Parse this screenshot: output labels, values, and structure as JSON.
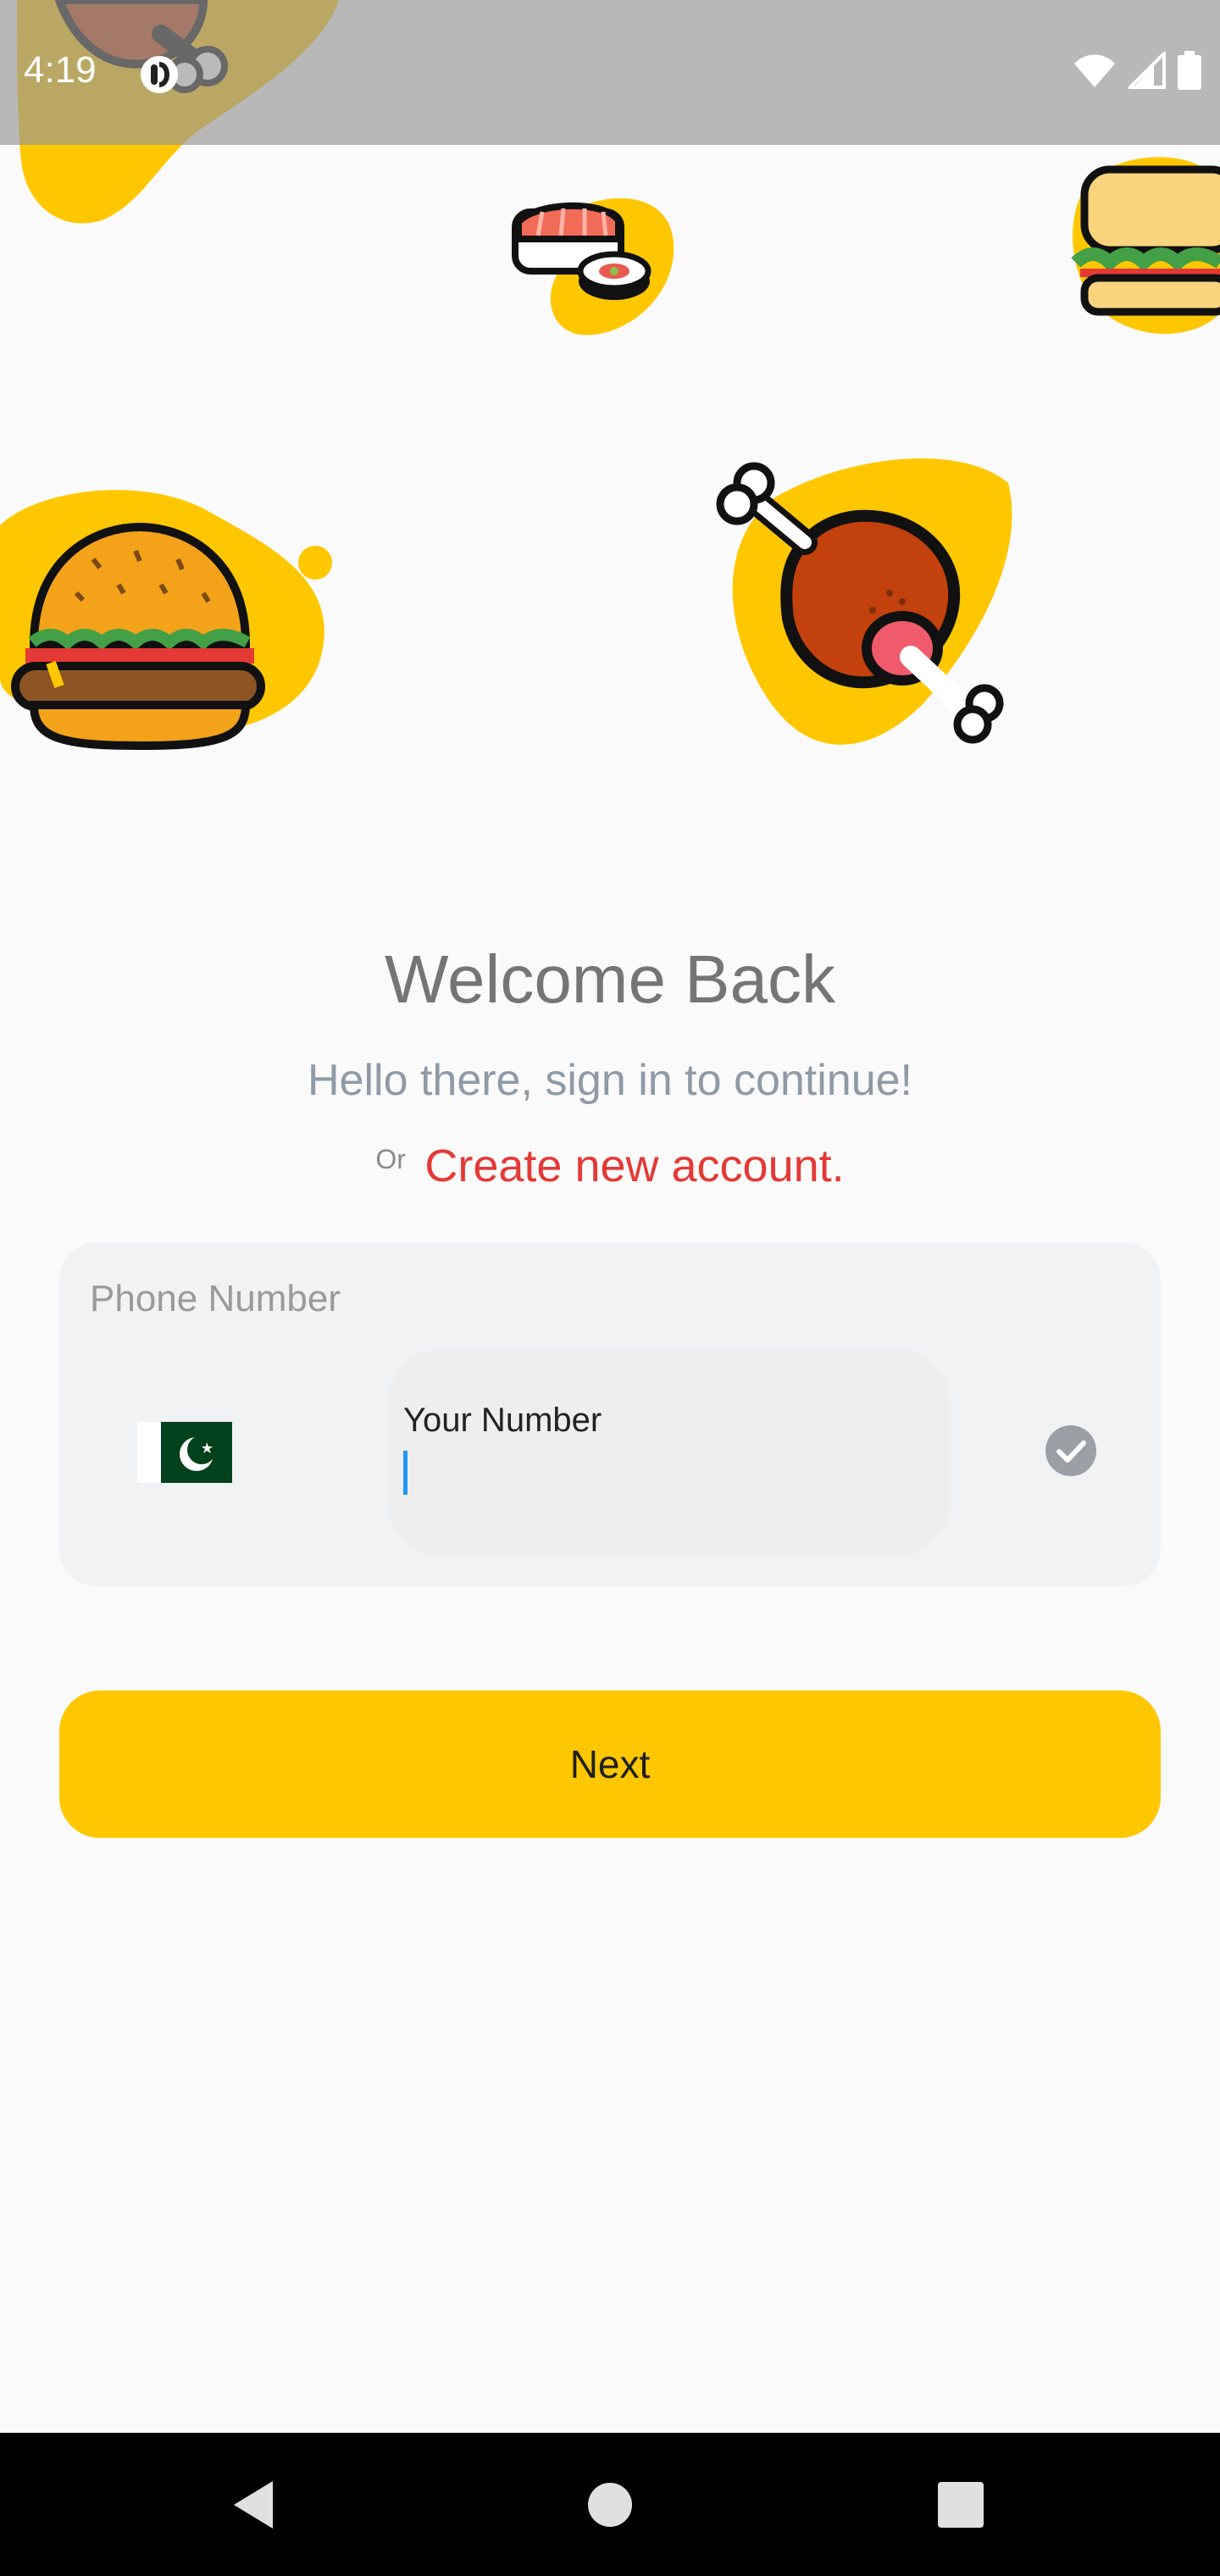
{
  "status_bar": {
    "time": "4:19",
    "icons": [
      "app-notification-icon",
      "wifi-icon",
      "signal-icon",
      "battery-icon"
    ]
  },
  "illustrations": [
    "drumstick-icon",
    "sushi-icon",
    "sandwich-icon",
    "burger-icon",
    "drumstick-icon"
  ],
  "welcome": {
    "title": "Welcome Back",
    "subtitle": "Hello there, sign in to continue!",
    "or_label": "Or",
    "create_link": "Create new account."
  },
  "phone": {
    "label": "Phone Number",
    "country_flag": "pakistan-flag-icon",
    "input_label": "Your Number",
    "input_value": "",
    "valid_icon": "check-circle-icon"
  },
  "next_button": {
    "label": "Next"
  },
  "colors": {
    "accent": "#ffc700",
    "link": "#e53935",
    "background": "#fafafa",
    "card": "#f1f2f4"
  },
  "nav_bar": {
    "buttons": [
      "back-icon",
      "home-icon",
      "recents-icon"
    ]
  }
}
